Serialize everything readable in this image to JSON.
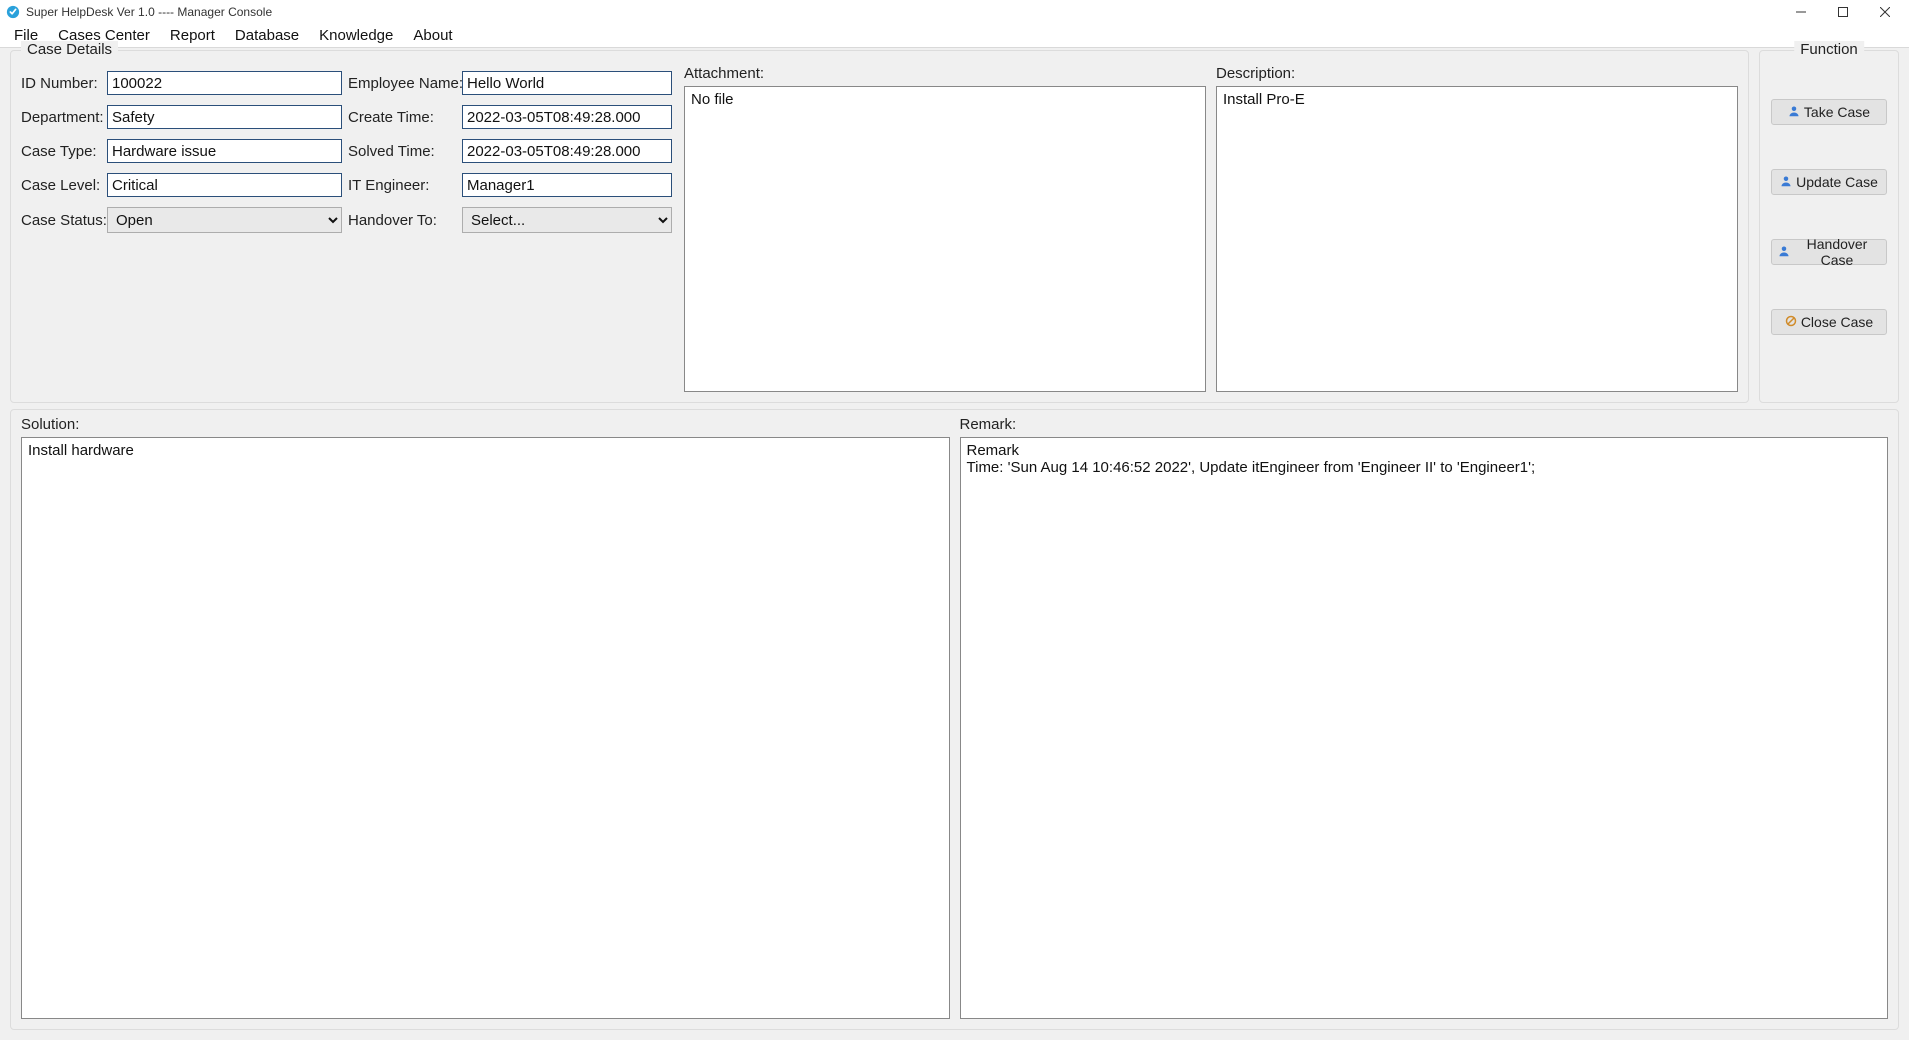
{
  "window": {
    "title": "Super HelpDesk Ver 1.0  ---- Manager Console"
  },
  "menubar": {
    "items": [
      "File",
      "Cases Center",
      "Report",
      "Database",
      "Knowledge",
      "About"
    ]
  },
  "case_details": {
    "legend": "Case Details",
    "labels": {
      "id_number": "ID Number:",
      "employee_name": "Employee Name:",
      "department": "Department:",
      "create_time": "Create Time:",
      "case_type": "Case Type:",
      "solved_time": "Solved Time:",
      "case_level": "Case Level:",
      "it_engineer": "IT Engineer:",
      "case_status": "Case Status:",
      "handover_to": "Handover To:"
    },
    "values": {
      "id_number": "100022",
      "employee_name": "Hello World",
      "department": "Safety",
      "create_time": "2022-03-05T08:49:28.000",
      "case_type": "Hardware issue",
      "solved_time": "2022-03-05T08:49:28.000",
      "case_level": "Critical",
      "it_engineer": "Manager1",
      "case_status": "Open",
      "handover_to": "Select..."
    },
    "attachment_label": "Attachment:",
    "attachment_text": "No file",
    "description_label": "Description:",
    "description_text": "Install Pro-E"
  },
  "function_panel": {
    "legend": "Function",
    "buttons": {
      "take": "Take Case",
      "update": "Update Case",
      "handover": "Handover Case",
      "close": "Close Case"
    }
  },
  "bottom": {
    "solution_label": "Solution:",
    "solution_text": "Install hardware",
    "remark_label": "Remark:",
    "remark_text": "Remark\nTime: 'Sun Aug 14 10:46:52 2022', Update itEngineer from 'Engineer II' to 'Engineer1';"
  }
}
